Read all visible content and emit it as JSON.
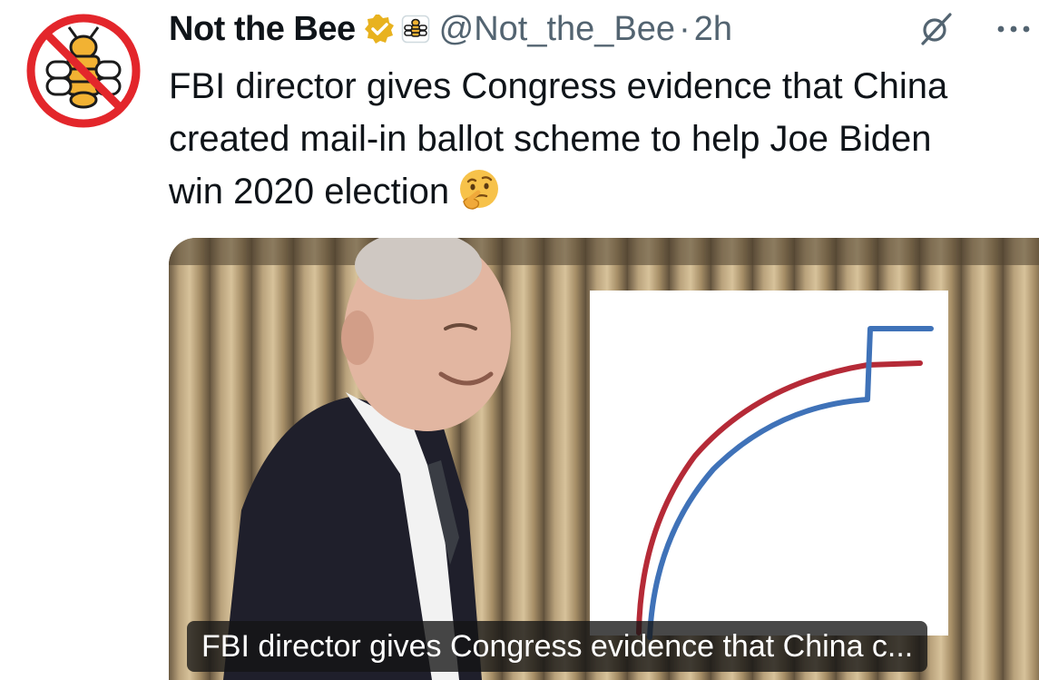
{
  "tweet": {
    "author_name": "Not the Bee",
    "handle": "@Not_the_Bee",
    "separator": "·",
    "time": "2h",
    "text_lines": [
      "FBI director gives Congress evidence that China",
      "created mail-in ballot scheme to help Joe Biden",
      "win 2020 election"
    ],
    "emoji": "thinking-face-icon"
  },
  "media": {
    "caption": "FBI director gives Congress evidence that China c...",
    "chart_colors": {
      "red": "#b52a37",
      "blue": "#3f72b8"
    }
  },
  "colors": {
    "text": "#0f1419",
    "secondary": "#536471",
    "verified_badge": "#e8b21f"
  }
}
